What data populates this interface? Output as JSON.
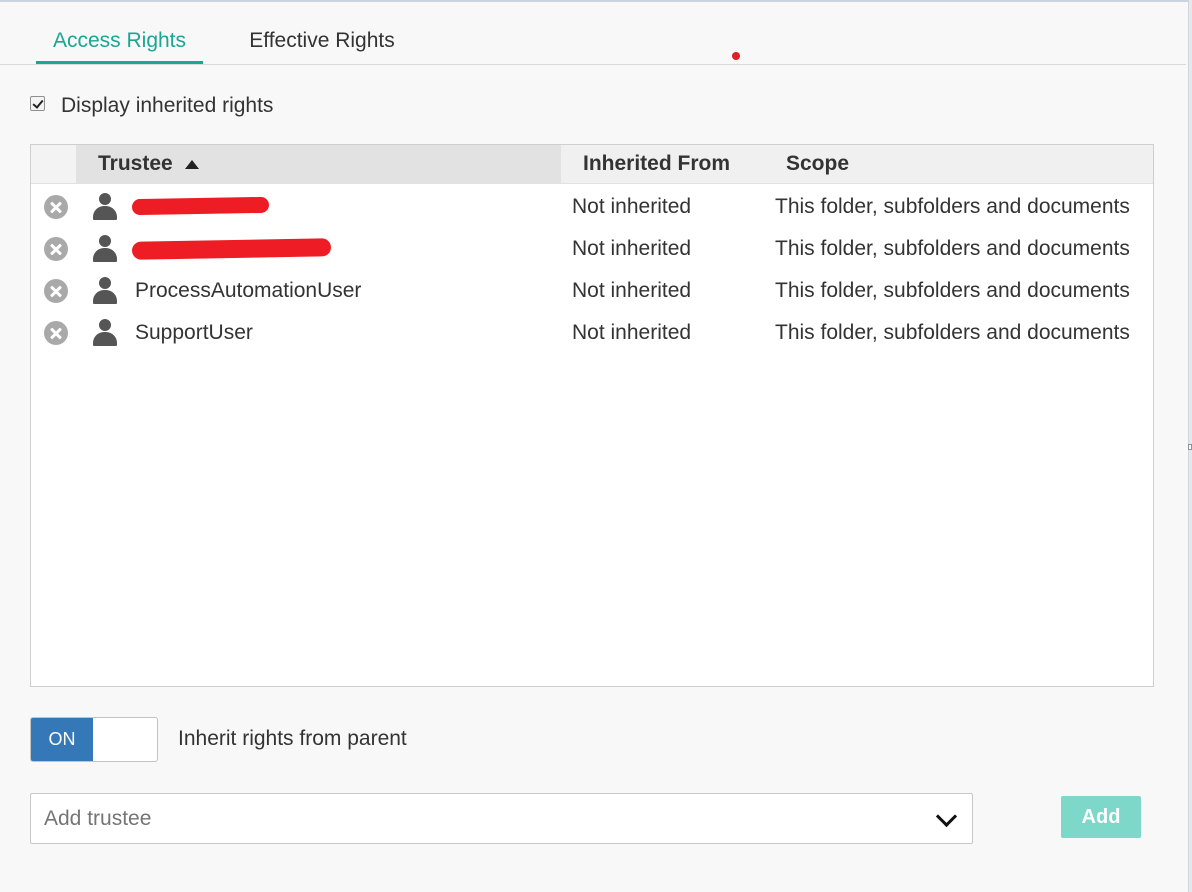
{
  "tabs": [
    {
      "label": "Access Rights",
      "active": true
    },
    {
      "label": "Effective Rights",
      "active": false
    }
  ],
  "display_inherited": {
    "label": "Display inherited rights",
    "checked": true
  },
  "table": {
    "columns": {
      "trustee": "Trustee",
      "inherited_from": "Inherited From",
      "scope": "Scope"
    },
    "sort": {
      "column": "trustee",
      "direction": "ascending"
    },
    "rows": [
      {
        "name": "",
        "redacted": true,
        "inherited_from": "Not inherited",
        "scope": "This folder, subfolders and documents"
      },
      {
        "name": "",
        "redacted": true,
        "inherited_from": "Not inherited",
        "scope": "This folder, subfolders and documents"
      },
      {
        "name": "ProcessAutomationUser",
        "redacted": false,
        "inherited_from": "Not inherited",
        "scope": "This folder, subfolders and documents"
      },
      {
        "name": "SupportUser",
        "redacted": false,
        "inherited_from": "Not inherited",
        "scope": "This folder, subfolders and documents"
      }
    ]
  },
  "inherit_toggle": {
    "state_label": "ON",
    "label": "Inherit rights from parent",
    "on": true
  },
  "add_trustee": {
    "placeholder": "Add trustee",
    "button_label": "Add"
  },
  "colors": {
    "accent": "#1aa692",
    "toggle_on": "#3578b8",
    "add_button": "#7dd8c9",
    "redaction": "#ee1c24"
  }
}
